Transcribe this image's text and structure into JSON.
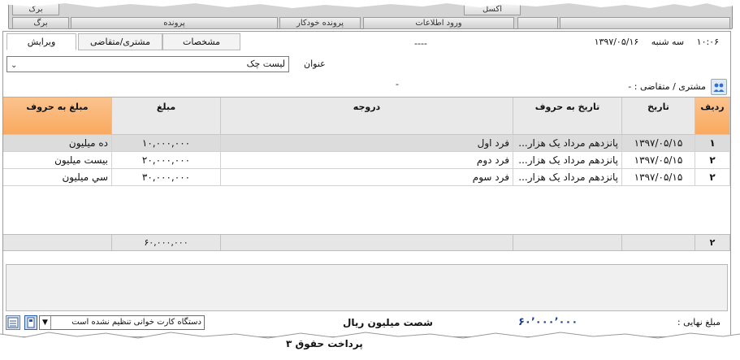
{
  "top_tabs": {
    "birg_upper": "برگ",
    "birg": "برگ",
    "parvande": "پرونده",
    "khodkar": "پرونده خودکار",
    "vorood": "ورود اطلاعات",
    "excel": "اکسل"
  },
  "sub_tabs": {
    "edit": "ویرایش",
    "customer": "مشتری/متقاضی",
    "specs": "مشخصات"
  },
  "header": {
    "center_dash": "----",
    "time": "۱۰:۰۶",
    "weekday": "سه شنبه",
    "date": "۱۳۹۷/۰۵/۱۶"
  },
  "title_field": {
    "label": "عنوان",
    "value": "لیست چک"
  },
  "customer": {
    "label": "مشتری / متقاضی : -",
    "dash": "-"
  },
  "grid": {
    "columns": {
      "row_no": "ردیف",
      "date": "تاریخ",
      "date_words": "تاریخ به حروف",
      "payee": "دروجه",
      "amount": "مبلغ",
      "amount_words": "مبلغ به حروف"
    },
    "rows": [
      {
        "no": "۱",
        "date": "۱۳۹۷/۰۵/۱۵",
        "date_words": "پانزدهم مرداد یک هزار...",
        "payee": "فرد اول",
        "amount": "۱۰,۰۰۰,۰۰۰",
        "amount_words": "ده میلیون"
      },
      {
        "no": "۲",
        "date": "۱۳۹۷/۰۵/۱۵",
        "date_words": "پانزدهم مرداد یک هزار...",
        "payee": "فرد دوم",
        "amount": "۲۰,۰۰۰,۰۰۰",
        "amount_words": "بیست  میلیون"
      },
      {
        "no": "۲",
        "date": "۱۳۹۷/۰۵/۱۵",
        "date_words": "پانزدهم مرداد یک هزار...",
        "payee": "فرد سوم",
        "amount": "۳۰,۰۰۰,۰۰۰",
        "amount_words": "سي  میلیون"
      }
    ],
    "footer": {
      "count": "۲",
      "total": "۶۰,۰۰۰,۰۰۰"
    }
  },
  "bottom": {
    "reader_status": "دستگاه کارت خوانی تنظیم نشده است",
    "amount_words": "شصت  میلیون  ریال",
    "final_value": "۶۰٬۰۰۰٬۰۰۰",
    "final_label": "مبلغ نهایی :"
  },
  "under_text": "پرداخت حقوق ۳"
}
